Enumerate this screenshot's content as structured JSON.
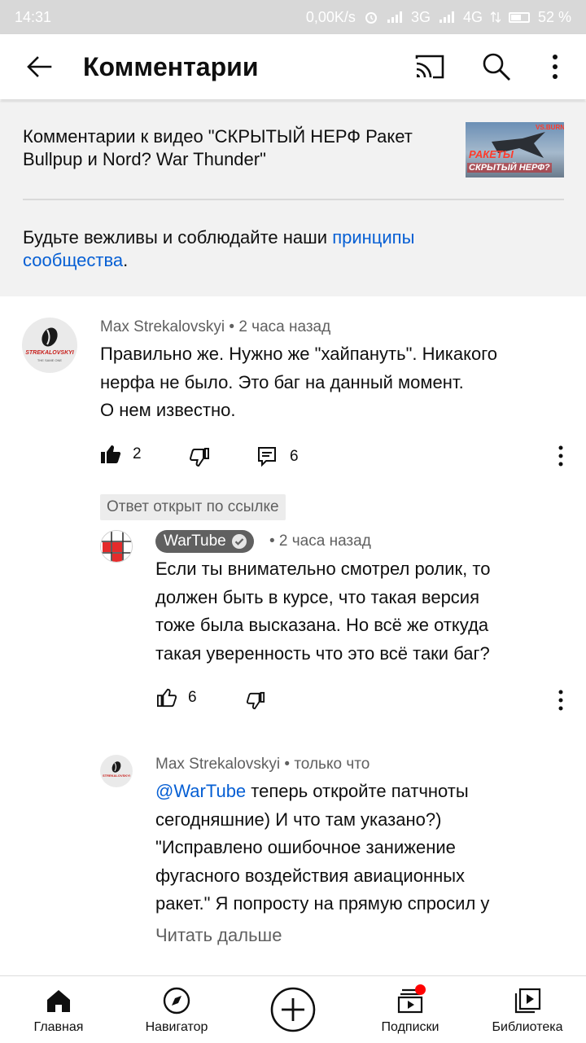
{
  "status_bar": {
    "time": "14:31",
    "net_speed": "0,00K/s",
    "net3g": "3G",
    "net4g": "4G",
    "battery": "52 %"
  },
  "top_bar": {
    "title": "Комментарии",
    "icons": [
      "back-arrow-icon",
      "cast-icon",
      "search-icon",
      "more-vert-icon"
    ]
  },
  "video": {
    "title": "Комментарии к видео \"СКРЫТЫЙ НЕРФ Ракет Bullpup и Nord? War Thunder\"",
    "thumb_text_top": "VS.BURNER",
    "thumb_text_1": "РАКЕТЫ",
    "thumb_text_2": "СКРЫТЫЙ НЕРФ?"
  },
  "guidelines": {
    "text": "Будьте вежливы и соблюдайте наши ",
    "link": "принципы сообщества",
    "end": "."
  },
  "comments": [
    {
      "author": "Max Strekalovskyi",
      "time": "• 2 часа назад",
      "text_lines": [
        "Правильно же. Нужно же \"хайпануть\". Никакого",
        "нерфа не было. Это баг на данный момент.",
        "О нем известно."
      ],
      "likes": "2",
      "replies": "6",
      "avatar_text": "STREKALOVSKYI",
      "avatar_sub": "THE SAME ONE"
    }
  ],
  "reply_chip": "Ответ открыт по ссылке",
  "replies": [
    {
      "author": "WarTube",
      "time": "• 2 часа назад",
      "text_lines": [
        "Если ты внимательно смотрел ролик, то",
        "должен быть в курсе, что такая версия",
        "тоже была высказана. Но всё же откуда",
        "такая уверенность что это всё таки баг?"
      ],
      "likes": "6"
    },
    {
      "author": "Max Strekalovskyi",
      "time": "• только что",
      "mention": "@WarTube",
      "text_first": " теперь откройте патчноты",
      "text_lines": [
        "сегодняшние) И что там указано?)",
        "\"Исправлено ошибочное занижение",
        "фугасного воздействия авиационных",
        "ракет.\" Я попросту на прямую спросил у"
      ],
      "read_more": "Читать дальше",
      "avatar_text": "STREKALOVSKYI"
    }
  ],
  "bottom_nav": [
    {
      "label": "Главная",
      "icon": "home-icon"
    },
    {
      "label": "Навигатор",
      "icon": "compass-icon"
    },
    {
      "label": "",
      "icon": "create-plus-icon"
    },
    {
      "label": "Подписки",
      "icon": "subscriptions-icon"
    },
    {
      "label": "Библиотека",
      "icon": "library-icon"
    }
  ],
  "colors": {
    "link": "#065fd4",
    "meta": "#606060",
    "notification_dot": "#ff0000"
  }
}
